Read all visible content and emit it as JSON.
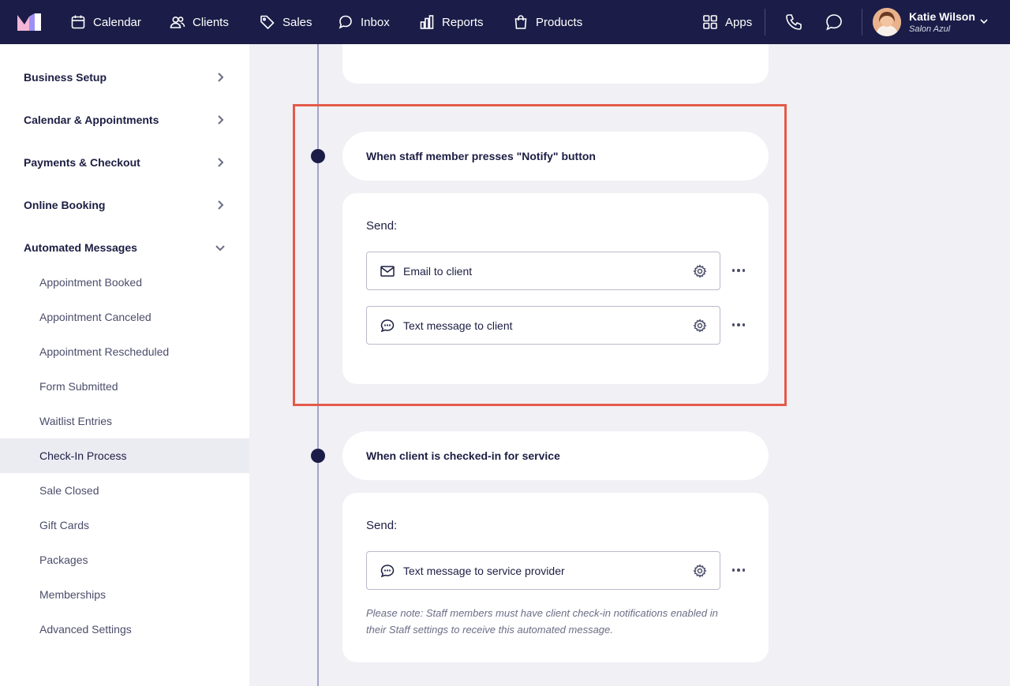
{
  "nav": {
    "items": [
      {
        "label": "Calendar",
        "icon": "calendar-icon"
      },
      {
        "label": "Clients",
        "icon": "users-icon"
      },
      {
        "label": "Sales",
        "icon": "tag-icon"
      },
      {
        "label": "Inbox",
        "icon": "inbox-icon"
      },
      {
        "label": "Reports",
        "icon": "bar-chart-icon"
      },
      {
        "label": "Products",
        "icon": "shopping-bag-icon"
      }
    ],
    "apps_label": "Apps",
    "user": {
      "name": "Katie Wilson",
      "business": "Salon Azul"
    }
  },
  "sidebar": {
    "sections": [
      {
        "label": "Business Setup",
        "expanded": false
      },
      {
        "label": "Calendar & Appointments",
        "expanded": false
      },
      {
        "label": "Payments & Checkout",
        "expanded": false
      },
      {
        "label": "Online Booking",
        "expanded": false
      },
      {
        "label": "Automated Messages",
        "expanded": true
      }
    ],
    "sub_items": [
      {
        "label": "Appointment Booked"
      },
      {
        "label": "Appointment Canceled"
      },
      {
        "label": "Appointment Rescheduled"
      },
      {
        "label": "Form Submitted"
      },
      {
        "label": "Waitlist Entries"
      },
      {
        "label": "Check-In Process",
        "active": true
      },
      {
        "label": "Sale Closed"
      },
      {
        "label": "Gift Cards"
      },
      {
        "label": "Packages"
      },
      {
        "label": "Memberships"
      },
      {
        "label": "Advanced Settings"
      }
    ]
  },
  "main": {
    "triggers": [
      {
        "title": "When staff member presses \"Notify\" button",
        "send_label": "Send:",
        "messages": [
          {
            "label": "Email to client",
            "icon": "mail-icon"
          },
          {
            "label": "Text message to client",
            "icon": "chat-icon"
          }
        ]
      },
      {
        "title": "When client is checked-in for service",
        "send_label": "Send:",
        "messages": [
          {
            "label": "Text message to service provider",
            "icon": "chat-icon"
          }
        ],
        "note": "Please note: Staff members must have client check-in notifications enabled in their Staff settings to receive this automated message."
      }
    ]
  },
  "colors": {
    "nav_bg": "#1b1d48",
    "highlight": "#e45a4a",
    "active_sidebar": "#ebebf2"
  }
}
